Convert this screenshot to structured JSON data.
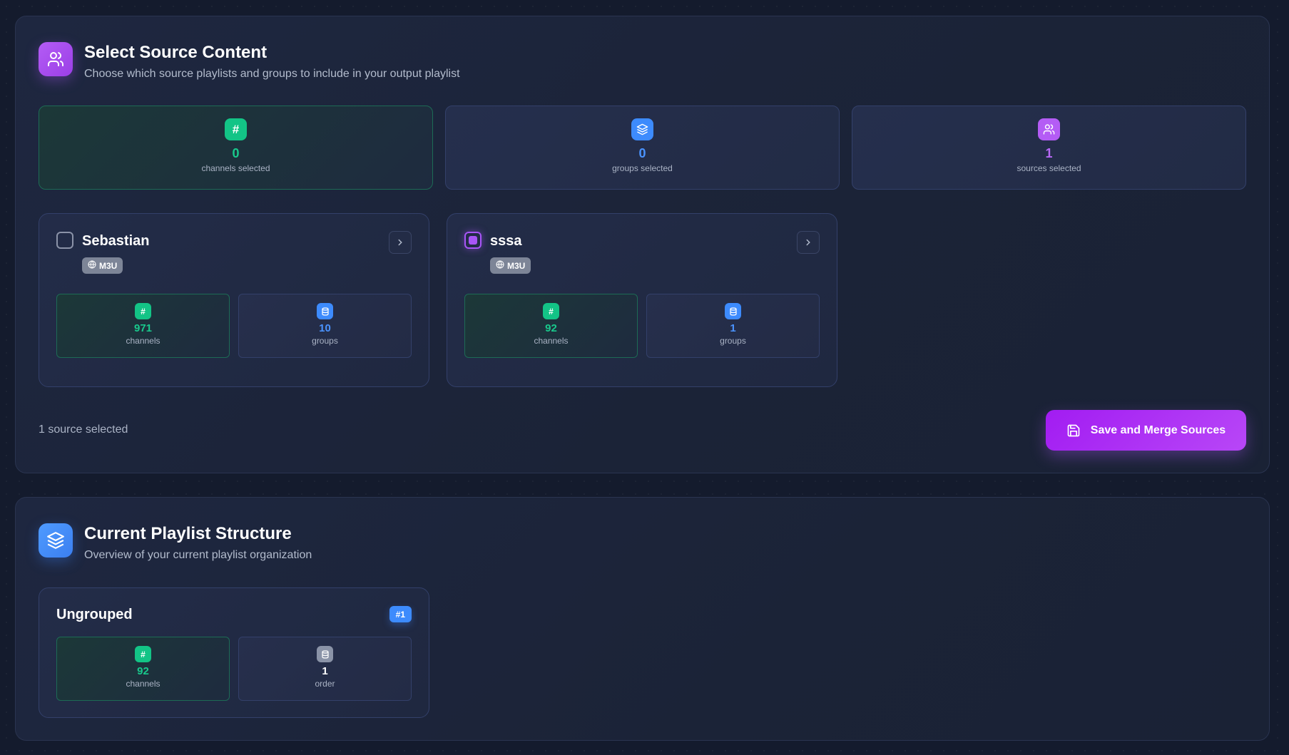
{
  "select_panel": {
    "title": "Select Source Content",
    "subtitle": "Choose which source playlists and groups to include in your output playlist",
    "stats": [
      {
        "value": "0",
        "label": "channels selected",
        "icon": "hash-icon",
        "color": "#13c486"
      },
      {
        "value": "0",
        "label": "groups selected",
        "icon": "layers-icon",
        "color": "#3d8bfd"
      },
      {
        "value": "1",
        "label": "sources selected",
        "icon": "users-icon",
        "color": "#b45cf5"
      }
    ],
    "sources": [
      {
        "name": "Sebastian",
        "checked": false,
        "type": "M3U",
        "channels": "971",
        "channels_label": "channels",
        "groups": "10",
        "groups_label": "groups"
      },
      {
        "name": "sssa",
        "checked": true,
        "type": "M3U",
        "channels": "92",
        "channels_label": "channels",
        "groups": "1",
        "groups_label": "groups"
      }
    ],
    "footer_text": "1 source selected",
    "save_label": "Save and Merge Sources"
  },
  "structure_panel": {
    "title": "Current Playlist Structure",
    "subtitle": "Overview of your current playlist organization",
    "groups": [
      {
        "name": "Ungrouped",
        "badge": "#1",
        "channels": "92",
        "channels_label": "channels",
        "order": "1",
        "order_label": "order"
      }
    ]
  },
  "colors": {
    "accent_purple": "#a855f7",
    "accent_blue": "#3d8bfd",
    "accent_green": "#13c486"
  }
}
